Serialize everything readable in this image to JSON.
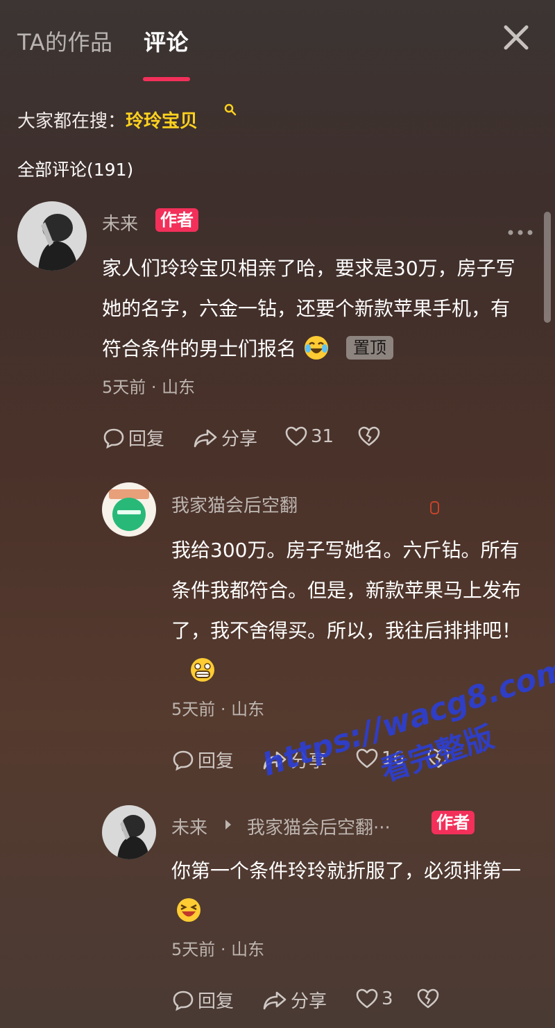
{
  "tabs": {
    "works": "TA的作品",
    "comments": "评论"
  },
  "hot_search": {
    "label": "大家都在搜：",
    "keyword": "玲玲宝贝"
  },
  "total_comments": "全部评论(191)",
  "actions": {
    "reply": "回复",
    "share": "分享"
  },
  "comments": [
    {
      "user": "未来",
      "badge": "作者",
      "text": "家人们玲玲宝贝相亲了哈，要求是30万，房子写她的名字，六金一钻，还要个新款苹果手机，有符合条件的男士们报名",
      "pinned": "置顶",
      "meta": "5天前 · 山东",
      "likes": "31"
    },
    {
      "user": "我家猫会后空翻",
      "text": "我给300万。房子写她名。六斤钻。所有条件我都符合。但是，新款苹果马上发布了，我不舍得买。所以，我往后排排吧！",
      "meta": "5天前 · 山东",
      "likes": "16"
    },
    {
      "user": "未来",
      "reply_to": "我家猫会后空翻···",
      "badge": "作者",
      "text": "你第一个条件玲玲就折服了，必须排第一",
      "meta": "5天前 · 山东",
      "likes": "3"
    }
  ],
  "watermark": {
    "line1": "https://wacg8.com",
    "line2": "看完整版"
  },
  "icons": [
    "close-icon",
    "search-icon",
    "more-icon",
    "reply-icon",
    "share-icon",
    "heart-icon",
    "dislike-icon"
  ],
  "colors": {
    "accent": "#f2305a",
    "keyword": "#ffd21e",
    "watermark": "#2c3fd2"
  }
}
